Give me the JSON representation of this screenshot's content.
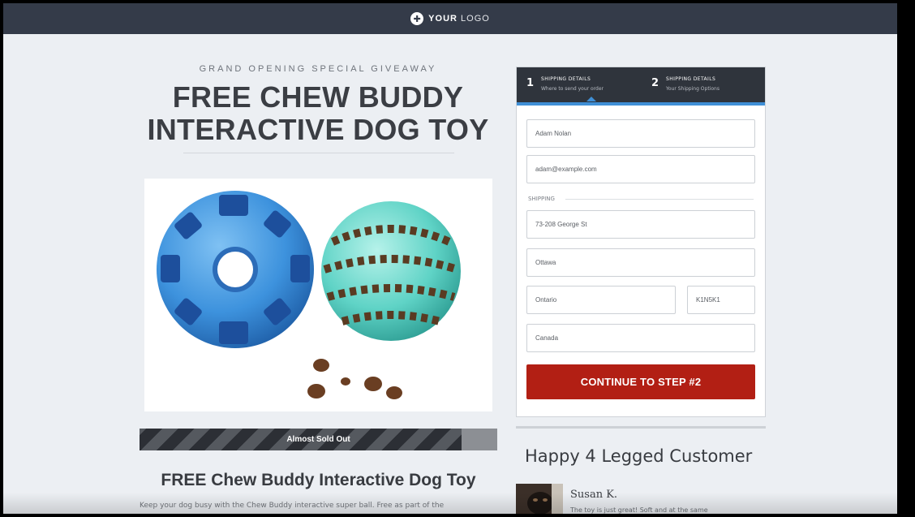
{
  "header": {
    "logo_icon": "plus-circle-icon",
    "logo_bold": "YOUR",
    "logo_light": "LOGO"
  },
  "hero": {
    "kicker": "GRAND OPENING SPECIAL GIVEAWAY",
    "headline_line1": "FREE CHEW BUDDY",
    "headline_line2": "INTERACTIVE DOG TOY",
    "image_subject": "blue and teal rubber chew ball toys with kibble"
  },
  "stock": {
    "label": "Almost Sold Out",
    "progress_fraction": 0.9
  },
  "product": {
    "title": "FREE Chew Buddy Interactive Dog Toy",
    "description": "Keep your dog busy with the Chew Buddy interactive super ball. Free as part of the"
  },
  "form": {
    "steps": [
      {
        "number": "1",
        "title": "SHIPPING DETAILS",
        "subtitle": "Where to send your order"
      },
      {
        "number": "2",
        "title": "SHIPPING DETAILS",
        "subtitle": "Your Shipping Options"
      }
    ],
    "fields": {
      "name": "Adam Nolan",
      "email": "adam@example.com",
      "address": "73-208 George St",
      "city": "Ottawa",
      "state": "Ontario",
      "zip": "K1N5K1",
      "country": "Canada"
    },
    "section_label": "SHIPPING",
    "submit_label": "CONTINUE TO STEP #2"
  },
  "testimonials": {
    "heading": "Happy 4 Legged Customer",
    "items": [
      {
        "name": "Susan K.",
        "text": "The toy is just great! Soft and at the same"
      }
    ]
  },
  "colors": {
    "topbar": "#343b49",
    "cta": "#b21f14",
    "step_accent": "#3f8fd6",
    "page_bg": "#eceff3"
  }
}
